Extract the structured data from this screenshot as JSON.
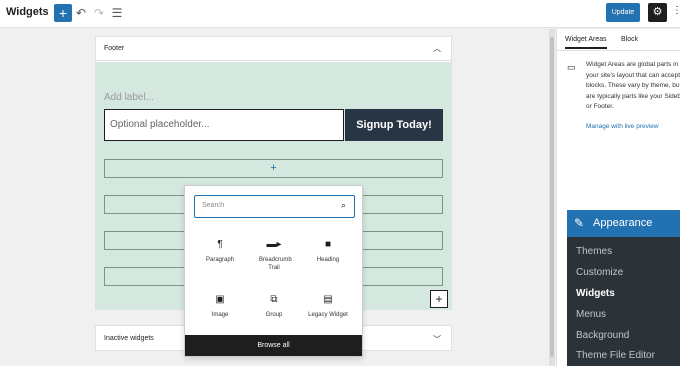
{
  "header": {
    "title": "Widgets",
    "add_glyph": "+",
    "update_label": "Update",
    "icons": [
      "undo-icon",
      "redo-icon",
      "list-view-icon",
      "gear-icon",
      "more-icon"
    ]
  },
  "footer_area": {
    "title": "Footer",
    "add_label": "Add label...",
    "input_placeholder": "Optional placeholder...",
    "button_label": "Signup Today!",
    "add_glyph": "+"
  },
  "inactive_area": {
    "title": "Inactive widgets"
  },
  "inserter": {
    "search_placeholder": "Search",
    "blocks": [
      {
        "label": "Paragraph",
        "icon": "paragraph-icon"
      },
      {
        "label": "Breadcrumb Trail",
        "icon": "breadcrumb-icon"
      },
      {
        "label": "Heading",
        "icon": "heading-icon"
      },
      {
        "label": "Image",
        "icon": "image-icon"
      },
      {
        "label": "Group",
        "icon": "group-icon"
      },
      {
        "label": "Legacy Widget",
        "icon": "legacy-widget-icon"
      }
    ],
    "browse_all": "Browse all"
  },
  "sidebar": {
    "tabs": [
      {
        "label": "Widget Areas",
        "active": true
      },
      {
        "label": "Block",
        "active": false
      }
    ],
    "description_lines": [
      "Widget Areas are global parts in",
      "your site's layout that can accept",
      "blocks. These vary by theme, but",
      "are typically parts like your Sideb",
      "or Footer."
    ],
    "manage_link": "Manage with live preview"
  },
  "admin_menu": {
    "heading": "Appearance",
    "items": [
      {
        "label": "Themes",
        "current": false
      },
      {
        "label": "Customize",
        "current": false
      },
      {
        "label": "Widgets",
        "current": true
      },
      {
        "label": "Menus",
        "current": false
      },
      {
        "label": "Background",
        "current": false
      },
      {
        "label": "Theme File Editor",
        "current": false
      }
    ]
  },
  "colors": {
    "accent": "#2271b1",
    "dark": "#1e1e1e",
    "widget_bg": "#d5e8df",
    "menu_bg": "#2c3338"
  }
}
